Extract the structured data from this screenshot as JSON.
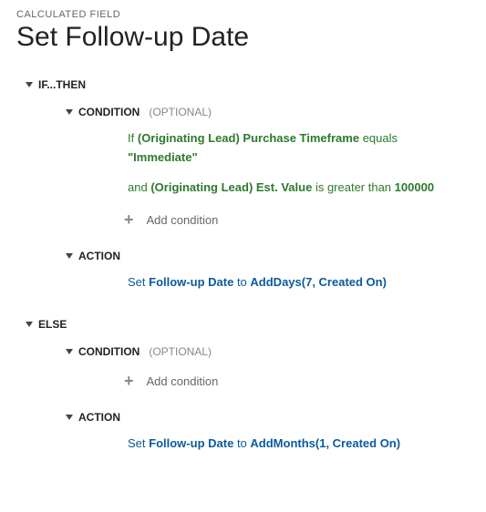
{
  "header": {
    "type_label": "CALCULATED FIELD",
    "title": "Set Follow-up Date"
  },
  "if_then": {
    "label": "IF...THEN",
    "condition": {
      "label": "CONDITION",
      "optional": "(OPTIONAL)",
      "lines": [
        {
          "prefix": "If",
          "field": "(Originating Lead) Purchase Timeframe",
          "operator": "equals",
          "value": "\"Immediate\""
        },
        {
          "prefix": "and",
          "field": "(Originating Lead) Est. Value",
          "operator": "is greater than",
          "value": "100000"
        }
      ],
      "add_label": "Add condition"
    },
    "action": {
      "label": "ACTION",
      "line": {
        "prefix": "Set",
        "field": "Follow-up Date",
        "middle": "to",
        "fn": "AddDays(7, Created On)"
      }
    }
  },
  "else": {
    "label": "ELSE",
    "condition": {
      "label": "CONDITION",
      "optional": "(OPTIONAL)",
      "add_label": "Add condition"
    },
    "action": {
      "label": "ACTION",
      "line": {
        "prefix": "Set",
        "field": "Follow-up Date",
        "middle": "to",
        "fn": "AddMonths(1, Created On)"
      }
    }
  }
}
